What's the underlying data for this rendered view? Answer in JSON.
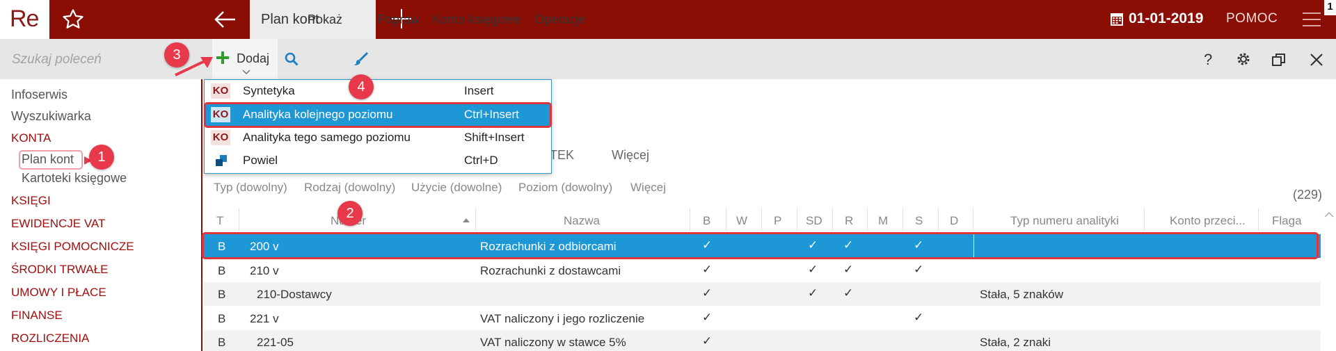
{
  "app": {
    "logo": "Re",
    "active_tab": "Plan kont",
    "date": "01-01-2019",
    "help": "POMOC",
    "badge": "1"
  },
  "sidebar": {
    "search_placeholder": "Szukaj poleceń",
    "items": [
      "Infoserwis",
      "Wyszukiwarka"
    ],
    "section_konta": "KONTA",
    "sub_items": [
      "Plan kont",
      "Kartoteki księgowe"
    ],
    "sections": [
      "KSIĘGI",
      "EWIDENCJE VAT",
      "KSIĘGI POMOCNICZE",
      "ŚRODKI TRWAŁE",
      "UMOWY I PŁACE",
      "FINANSE",
      "ROZLICZENIA"
    ]
  },
  "toolbar": {
    "add": "Dodaj",
    "show": "Pokaż",
    "edit": "Popraw",
    "account": "Konto księgowe",
    "operations": "Operacje"
  },
  "dropdown": {
    "items": [
      {
        "badge": "KO",
        "label": "Syntetyka",
        "shortcut": "Insert"
      },
      {
        "badge": "KO",
        "label": "Analityka kolejnego poziomu",
        "shortcut": "Ctrl+Insert"
      },
      {
        "badge": "KO",
        "label": "Analityka tego samego poziomu",
        "shortcut": "Shift+Insert"
      },
      {
        "badge": "",
        "label": "Powiel",
        "shortcut": "Ctrl+D"
      }
    ]
  },
  "tabs": {
    "partial": "TEK",
    "more": "Więcej"
  },
  "filters": [
    "Typ (dowolny)",
    "Rodzaj (dowolny)",
    "Użycie (dowolne)",
    "Poziom (dowolny)",
    "Więcej"
  ],
  "count": "(229)",
  "columns": {
    "t": "T",
    "number": "Numer",
    "name": "Nazwa",
    "b": "B",
    "w": "W",
    "p": "P",
    "sd": "SD",
    "r": "R",
    "m": "M",
    "s": "S",
    "d": "D",
    "typ": "Typ numeru analityki",
    "konto": "Konto przeci...",
    "flaga": "Flaga"
  },
  "rows": [
    {
      "t": "B",
      "number": "200 v",
      "name": "Rozrachunki z odbiorcami",
      "b": true,
      "sd": true,
      "r": true,
      "s": true,
      "typ": "",
      "selected": true
    },
    {
      "t": "B",
      "number": "210 v",
      "name": "Rozrachunki z dostawcami",
      "b": true,
      "sd": true,
      "r": true,
      "s": true,
      "typ": ""
    },
    {
      "t": "B",
      "number": "210-Dostawcy",
      "name": "",
      "b": true,
      "sd": true,
      "r": true,
      "s": false,
      "typ": "Stała, 5 znaków"
    },
    {
      "t": "B",
      "number": "221 v",
      "name": "VAT naliczony i jego rozliczenie",
      "b": true,
      "sd": false,
      "r": false,
      "s": true,
      "typ": ""
    },
    {
      "t": "B",
      "number": "221-05",
      "name": "VAT naliczony w stawce 5%",
      "b": true,
      "sd": false,
      "r": false,
      "s": false,
      "typ": "Stała, 2 znaki"
    }
  ],
  "callouts": [
    "1",
    "2",
    "3",
    "4"
  ],
  "colors": {
    "brand": "#8b0e05",
    "selection": "#1e97d6",
    "annotation": "#e8394a"
  }
}
